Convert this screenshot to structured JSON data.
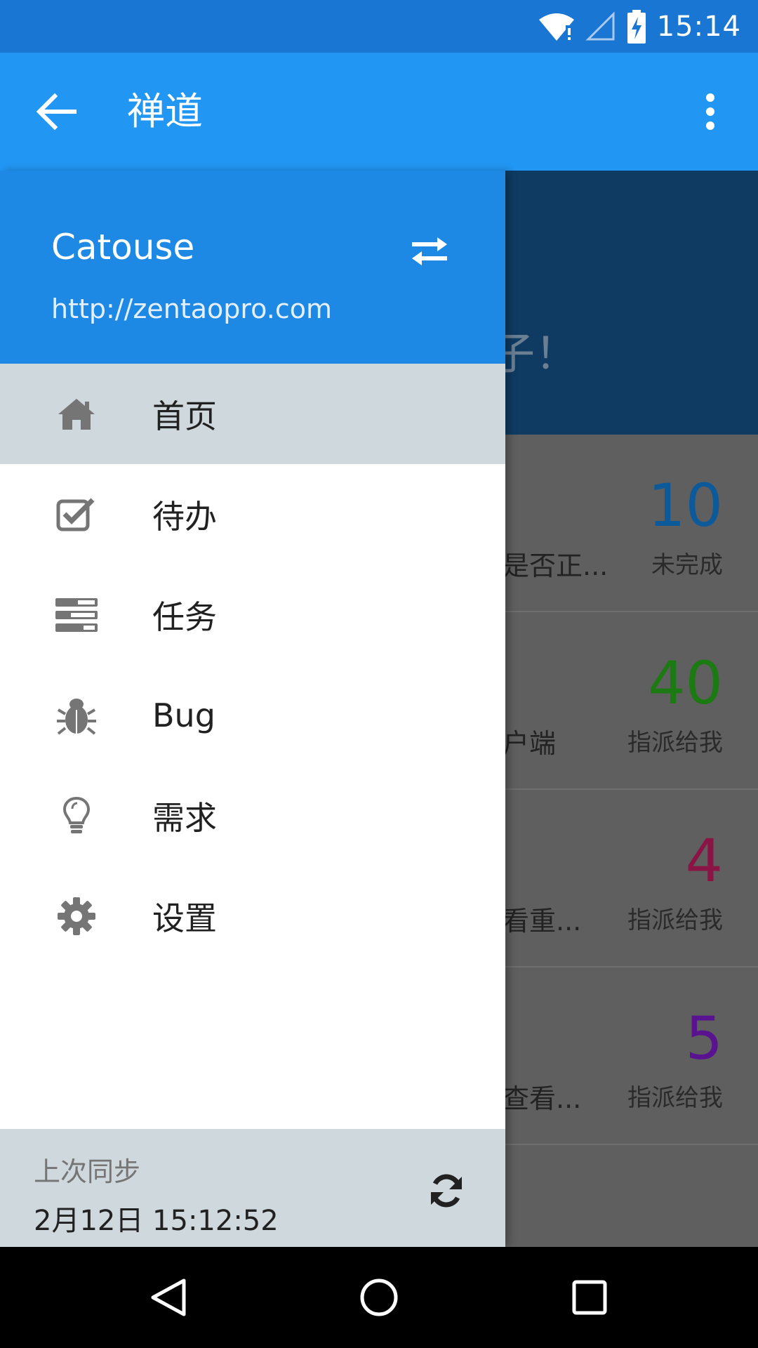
{
  "status_bar": {
    "time": "15:14",
    "icons": [
      "wifi-alert-icon",
      "signal-empty-icon",
      "battery-charging-icon"
    ]
  },
  "app_bar": {
    "title": "禅道",
    "back_icon": "arrow-left-icon",
    "more_icon": "more-vertical-icon"
  },
  "drawer": {
    "account": {
      "name": "Catouse",
      "url": "http://zentaopro.com",
      "switch_icon": "swap-icon"
    },
    "menu": [
      {
        "label": "首页",
        "icon": "home-icon",
        "active": true
      },
      {
        "label": "待办",
        "icon": "checkbox-icon",
        "active": false
      },
      {
        "label": "任务",
        "icon": "tasks-icon",
        "active": false
      },
      {
        "label": "Bug",
        "icon": "bug-icon",
        "active": false
      },
      {
        "label": "需求",
        "icon": "lightbulb-icon",
        "active": false
      },
      {
        "label": "设置",
        "icon": "gear-icon",
        "active": false
      }
    ],
    "footer": {
      "sync_title": "上次同步",
      "sync_time": "2月12日 15:12:52",
      "sync_icon": "refresh-icon"
    }
  },
  "background": {
    "greeting_fragment": "子！",
    "rows": [
      {
        "snippet": "是否正...",
        "number": "10",
        "label": "未完成",
        "color": "#0d5a9a"
      },
      {
        "snippet": "户端",
        "number": "40",
        "label": "指派给我",
        "color": "#1b7a12"
      },
      {
        "snippet": "看重...",
        "number": "4",
        "label": "指派给我",
        "color": "#8a1445"
      },
      {
        "snippet": "查看...",
        "number": "5",
        "label": "指派给我",
        "color": "#5a1390"
      }
    ]
  },
  "nav_bar": {
    "back_icon": "nav-back-icon",
    "home_icon": "nav-home-icon",
    "recents_icon": "nav-recents-icon"
  }
}
